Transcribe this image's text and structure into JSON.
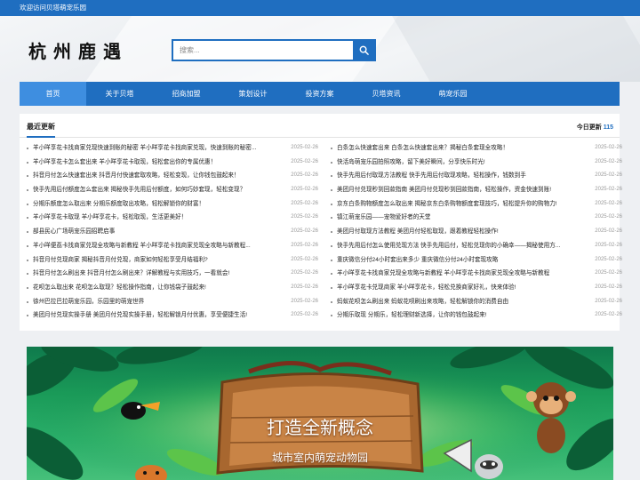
{
  "topbar": {
    "welcome": "欢迎访问贝塔萌宠乐园"
  },
  "header": {
    "logo": "杭州鹿遇"
  },
  "search": {
    "placeholder": "搜索..."
  },
  "nav": {
    "items": [
      "首页",
      "关于贝塔",
      "招商加盟",
      "策划设计",
      "投资方案",
      "贝塔资讯",
      "萌宠乐园"
    ]
  },
  "updates": {
    "title": "最近更新",
    "today_label": "今日更新",
    "today_count": "115",
    "left": [
      {
        "title": "羊小咩享花卡找商家兑现快速到账的秘密 羊小咩享花卡找商家兑现，快速到账的秘密...",
        "date": "2025-02-26"
      },
      {
        "title": "羊小咩享花卡怎么套出来 羊小咩享花卡取现，轻松套出你的专属优惠！",
        "date": "2025-02-26"
      },
      {
        "title": "抖音月付怎么快速套出来 抖音月付快速套取攻略，轻松变现，让你钱包鼓起来！",
        "date": "2025-02-26"
      },
      {
        "title": "快手先用后付额度怎么套出来 揭秘快手先用后付额度，如何巧妙套现，轻松变现？",
        "date": "2025-02-26"
      },
      {
        "title": "分期乐额度怎么取出来 分期乐额度取出攻略，轻松解锁你的财富！",
        "date": "2025-02-26"
      },
      {
        "title": "羊小咩享花卡取现 羊小咩享花卡，轻松取现，生活更美好！",
        "date": "2025-02-26"
      },
      {
        "title": "部县民心广场萌宠乐园招聘启事",
        "date": "2025-02-26"
      },
      {
        "title": "羊小咩便荔卡找商家兑现全攻略与新教程 羊小咩享花卡找商家兑现全攻略与新教程...",
        "date": "2025-02-26"
      },
      {
        "title": "抖音月付兑现商家 揭秘抖音月付兑现，商家如何轻松享受月结福利?",
        "date": "2025-02-26"
      },
      {
        "title": "抖音月付怎么刷出来 抖音月付怎么刷出来？详解教程与实用技巧，一看就会!",
        "date": "2025-02-26"
      },
      {
        "title": "花呗怎么取出来 花呗怎么取现？轻松操作指南，让你钱袋子鼓起来!",
        "date": "2025-02-26"
      },
      {
        "title": "徐州巴拉巴拉萌宠乐园，乐园里的萌宠世界",
        "date": "2025-02-26"
      },
      {
        "title": "美团月付兑现实操手册 美团月付兑现实操手册，轻松解锁月付优惠，享受便捷生活!",
        "date": "2025-02-26"
      }
    ],
    "right": [
      {
        "title": "白条怎么快速套出来 白条怎么快速套出来？揭秘白条套现全攻略！",
        "date": "2025-02-26"
      },
      {
        "title": "快活岛萌宠乐园拍照攻略，留下美好瞬间，分享快乐时光!",
        "date": "2025-02-26"
      },
      {
        "title": "快手先用后付取现方法教程 快手先用后付取现攻略，轻松操作，钱数到手",
        "date": "2025-02-26"
      },
      {
        "title": "美团月付兑现秒到回款指南 美团月付兑现秒到回款指南，轻松操作，资金快速到账!",
        "date": "2025-02-26"
      },
      {
        "title": "京东白条购物额度怎么取出来 揭秘京东白条购物额度套现技巧，轻松提升你的购物力!",
        "date": "2025-02-26"
      },
      {
        "title": "镇江萌宠乐园——宠物爱好者的天堂",
        "date": "2025-02-26"
      },
      {
        "title": "美团月付取现方法教程 美团月付轻松取现，跟着教程轻松操作!",
        "date": "2025-02-26"
      },
      {
        "title": "快手先用后付怎么使用兑现方法 快手先用后付，轻松兑现你的小确幸——揭秘使用方...",
        "date": "2025-02-26"
      },
      {
        "title": "重庆微信分付24小时套出来多少 重庆微信分付24小时套现攻略",
        "date": "2025-02-26"
      },
      {
        "title": "羊小咩享花卡找商家兑现全攻略与新教程 羊小咩享花卡找商家兑现全攻略与新教程",
        "date": "2025-02-26"
      },
      {
        "title": "羊小咩享花卡兑现商家 羊小咩享花卡，轻松兑换商家好礼，快来体验!",
        "date": "2025-02-26"
      },
      {
        "title": "蚂蚁花呗怎么刷出来 蚂蚁花呗刷出来攻略，轻松解锁你的消费自由",
        "date": "2025-02-26"
      },
      {
        "title": "分期乐取现 分期乐，轻松理财新选择，让你的钱包鼓起来!",
        "date": "2025-02-26"
      }
    ]
  },
  "banner": {
    "headline": "打造全新概念",
    "subline": "城市室内萌宠动物园"
  }
}
